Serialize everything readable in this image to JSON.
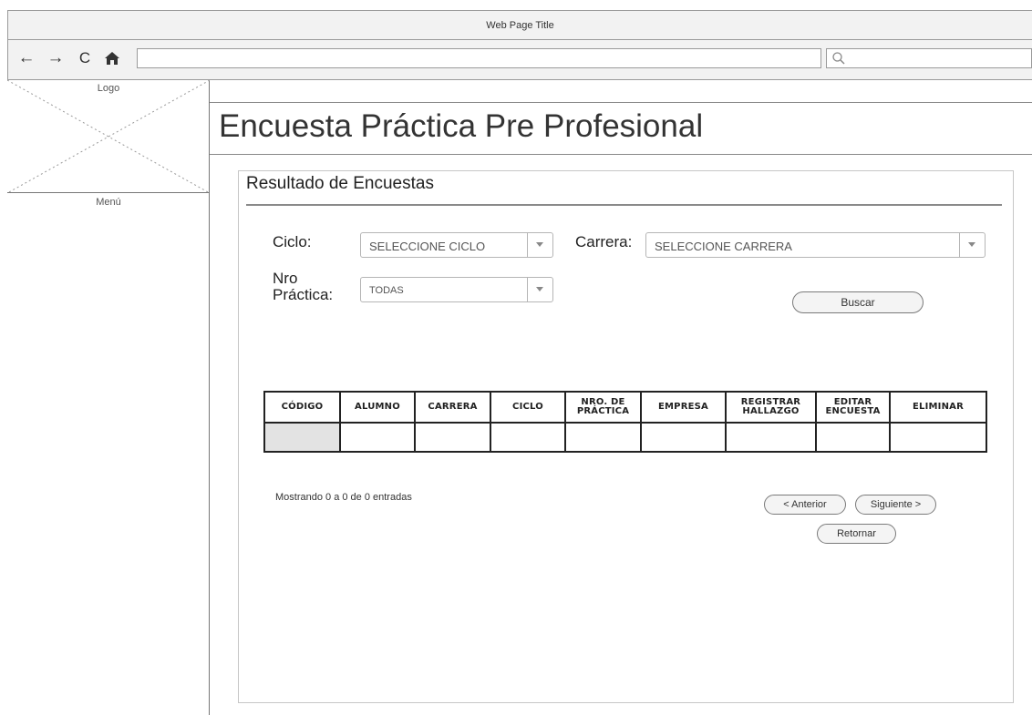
{
  "browser": {
    "title": "Web Page Title",
    "nav": {
      "back_icon": "←",
      "forward_icon": "→",
      "reload_icon": "C",
      "home_icon": "⌂"
    }
  },
  "sidebar": {
    "logo_label": "Logo",
    "menu_label": "Menú"
  },
  "page": {
    "title": "Encuesta Práctica Pre Profesional"
  },
  "panel": {
    "title": "Resultado de Encuestas"
  },
  "filters": {
    "ciclo_label": "Ciclo:",
    "ciclo_value": "SELECCIONE CICLO",
    "carrera_label": "Carrera:",
    "carrera_value": "SELECCIONE CARRERA",
    "nro_label_line1": "Nro",
    "nro_label_line2": "Práctica:",
    "nro_value": "TODAS",
    "search_button": "Buscar"
  },
  "table": {
    "columns": [
      {
        "line1": "CÓDIGO",
        "line2": ""
      },
      {
        "line1": "ALUMNO",
        "line2": ""
      },
      {
        "line1": "CARRERA",
        "line2": ""
      },
      {
        "line1": "CICLO",
        "line2": ""
      },
      {
        "line1": "NRO. DE",
        "line2": "PRÁCTICA"
      },
      {
        "line1": "EMPRESA",
        "line2": ""
      },
      {
        "line1": "REGISTRAR",
        "line2": "HALLAZGO"
      },
      {
        "line1": "EDITAR",
        "line2": "ENCUESTA"
      },
      {
        "line1": "ELIMINAR",
        "line2": ""
      }
    ]
  },
  "pagination": {
    "info": "Mostrando 0 a 0 de 0 entradas",
    "previous": "< Anterior",
    "next": "Siguiente >",
    "back": "Retornar"
  }
}
